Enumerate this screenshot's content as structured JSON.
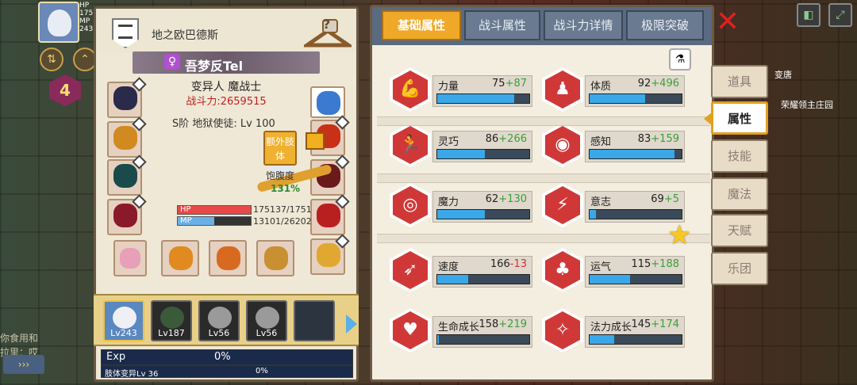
{
  "hud": {
    "stat_lines": [
      "HP",
      "17513",
      "MP",
      "243"
    ],
    "level": "4",
    "chat_lines": [
      "你食用和",
      "拉里：哎"
    ],
    "chat_button": "›››"
  },
  "left": {
    "region": "地之欧巴德斯",
    "help_glyph": "?",
    "gender_symbol": "♀",
    "name": "吾梦反Tel",
    "class_title": "变异人 魔战士",
    "power": "战斗力:2659515",
    "rank_line": "S阶 地狱使徒: Lv 100",
    "extra_label": "额外肢体",
    "satiety_label": "饱腹度",
    "satiety_value": "131%",
    "hp_label": "HP",
    "hp_value": "175137/1751",
    "hp_fill": 1.0,
    "mp_label": "MP",
    "mp_value": "13101/26202",
    "mp_fill": 0.5,
    "party": [
      {
        "lv": "Lv243"
      },
      {
        "lv": "Lv187"
      },
      {
        "lv": "Lv56"
      },
      {
        "lv": "Lv56"
      },
      {
        "lv": ""
      }
    ],
    "exp_label": "Exp",
    "exp_value": "0%",
    "mutation_label": "肢体变异Lv 36",
    "mutation_value": "0%"
  },
  "tabs": [
    "基础属性",
    "战斗属性",
    "战斗力详情",
    "极限突破"
  ],
  "stats": [
    {
      "name": "力量",
      "base": "75",
      "bonus": "+87",
      "sign": "p",
      "fill": 0.84,
      "icon": "arm-icon",
      "glyph": "💪"
    },
    {
      "name": "体质",
      "base": "92",
      "bonus": "+496",
      "sign": "p",
      "fill": 0.6,
      "icon": "torso-icon",
      "glyph": "♟"
    },
    {
      "name": "灵巧",
      "base": "86",
      "bonus": "+266",
      "sign": "p",
      "fill": 0.52,
      "icon": "runner-icon",
      "glyph": "🏃"
    },
    {
      "name": "感知",
      "base": "83",
      "bonus": "+159",
      "sign": "p",
      "fill": 0.92,
      "icon": "eye-icon",
      "glyph": "◉"
    },
    {
      "name": "魔力",
      "base": "62",
      "bonus": "+130",
      "sign": "p",
      "fill": 0.52,
      "icon": "spiral-icon",
      "glyph": "◎"
    },
    {
      "name": "意志",
      "base": "69",
      "bonus": "+5",
      "sign": "p",
      "fill": 0.07,
      "icon": "will-icon",
      "glyph": "⚡"
    },
    {
      "name": "速度",
      "base": "166",
      "bonus": "-13",
      "sign": "n",
      "fill": 0.34,
      "icon": "speed-icon",
      "glyph": "➶"
    },
    {
      "name": "运气",
      "base": "115",
      "bonus": "+188",
      "sign": "p",
      "fill": 0.44,
      "icon": "clover-icon",
      "glyph": "♣"
    },
    {
      "name": "生命成长",
      "base": "158",
      "bonus": "+219",
      "sign": "p",
      "fill": 0.02,
      "icon": "life-growth-icon",
      "glyph": "♥"
    },
    {
      "name": "法力成长",
      "base": "145",
      "bonus": "+174",
      "sign": "p",
      "fill": 0.27,
      "icon": "mana-growth-icon",
      "glyph": "✧"
    }
  ],
  "side_tabs": [
    "道具",
    "属性",
    "技能",
    "魔法",
    "天赋",
    "乐团"
  ],
  "map_labels": [
    "荣耀领主庄园",
    "变唐"
  ],
  "close_glyph": "✕",
  "potion_glyph": "⚗",
  "star_glyph": "★"
}
